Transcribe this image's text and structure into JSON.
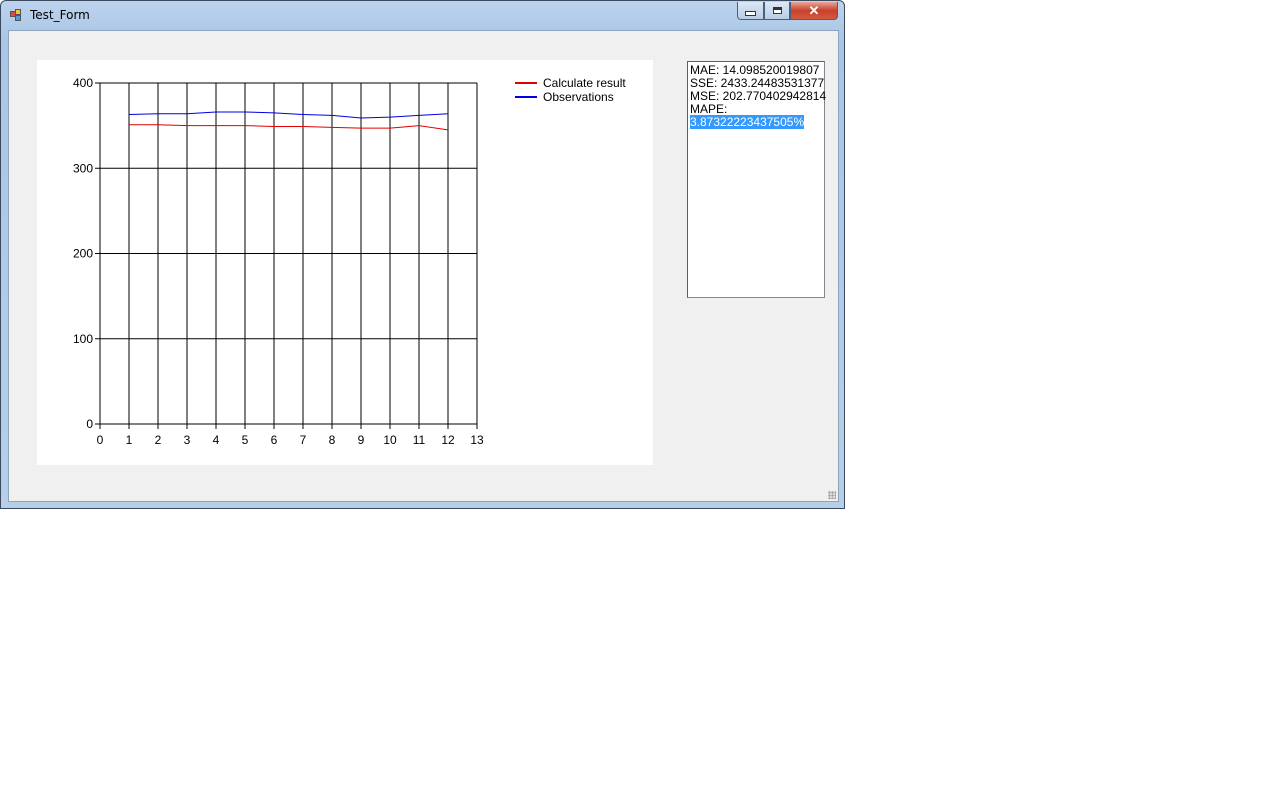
{
  "window": {
    "title": "Test_Form",
    "close_glyph": "✕"
  },
  "colors": {
    "calculated": "#e00000",
    "observations": "#0000e0",
    "selection": "#3399ff"
  },
  "results": {
    "mae": "MAE: 14.098520019807",
    "sse": "SSE: 2433.24483531377",
    "mse": "MSE: 202.770402942814",
    "mape_label": "MAPE:",
    "mape_value": "3.87322223437505%"
  },
  "chart_data": {
    "type": "line",
    "xlim": [
      0,
      13
    ],
    "ylim": [
      0,
      400
    ],
    "x_ticks": [
      0,
      1,
      2,
      3,
      4,
      5,
      6,
      7,
      8,
      9,
      10,
      11,
      12,
      13
    ],
    "y_ticks": [
      0,
      100,
      200,
      300,
      400
    ],
    "grid": true,
    "legend_position": "top-right",
    "x": [
      1,
      2,
      3,
      4,
      5,
      6,
      7,
      8,
      9,
      10,
      11,
      12
    ],
    "series": [
      {
        "name": "Calculate result",
        "color": "#e00000",
        "values": [
          351,
          351,
          350,
          350,
          350,
          349,
          349,
          348,
          347,
          347,
          350,
          345
        ]
      },
      {
        "name": "Observations",
        "color": "#0000e0",
        "values": [
          363,
          364,
          364,
          366,
          366,
          365,
          363,
          362,
          359,
          360,
          362,
          364
        ]
      }
    ]
  }
}
